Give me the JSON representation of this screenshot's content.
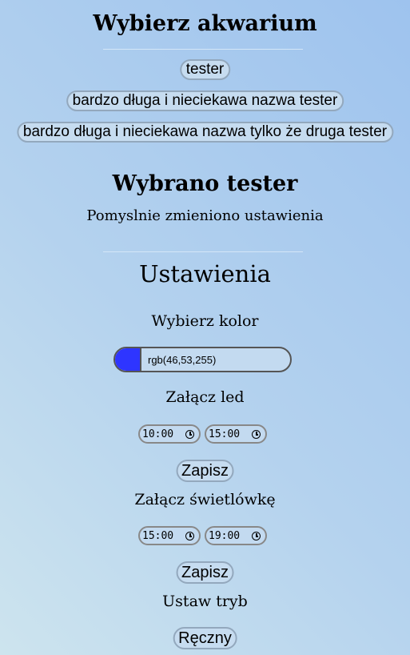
{
  "aquarium_picker": {
    "title": "Wybierz akwarium",
    "options": [
      "tester",
      "bardzo długa i nieciekawa nazwa tester",
      "bardzo długa i nieciekawa nazwa tylko że druga tester"
    ]
  },
  "selection": {
    "heading": "Wybrano tester",
    "message": "Pomyslnie zmieniono ustawienia"
  },
  "settings": {
    "title": "Ustawienia",
    "color": {
      "label": "Wybierz kolor",
      "value": "rgb(46,53,255)",
      "swatch": "#2e35ff"
    },
    "led": {
      "label": "Załącz led",
      "start": "10:00",
      "end": "15:00",
      "save_label": "Zapisz"
    },
    "fluorescent": {
      "label": "Załącz świetlówkę",
      "start": "15:00",
      "end": "19:00",
      "save_label": "Zapisz"
    },
    "mode": {
      "label": "Ustaw tryb",
      "value": "Ręczny"
    }
  }
}
